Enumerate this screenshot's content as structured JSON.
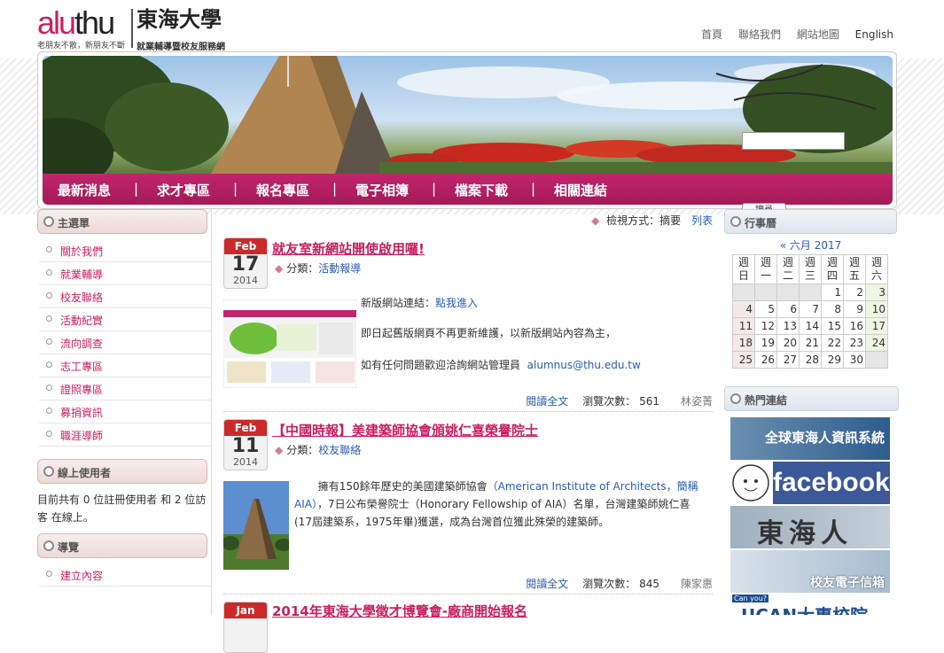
{
  "header": {
    "logo_a": "alu",
    "logo_b": "thu",
    "logo_cn": "東海大學",
    "logo_tagline": "老朋友不散，新朋友不斷",
    "logo_sub": "就業輔導暨校友服務網",
    "top_links": [
      "首頁",
      "聯絡我們",
      "網站地圖",
      "English"
    ]
  },
  "nav": {
    "items": [
      "最新消息",
      "求才專區",
      "報名專區",
      "電子相簿",
      "檔案下載",
      "相關連結"
    ],
    "separator": "|",
    "search_button": "搜尋"
  },
  "left": {
    "main_menu_title": "主選單",
    "menu": [
      "關於我們",
      "就業輔導",
      "校友聯絡",
      "活動紀實",
      "流向調查",
      "志工專區",
      "證照專區",
      "募捐資訊",
      "職涯導師"
    ],
    "online_title": "線上使用者",
    "online_text": "目前共有 0 位註冊使用者 和 2 位訪客 在線上。",
    "nav_title": "導覽",
    "nav_items": [
      "建立內容"
    ]
  },
  "main": {
    "view_label": "檢視方式：摘要",
    "view_list": "列表",
    "posts": [
      {
        "month": "Feb",
        "day": "17",
        "year": "2014",
        "title": "就友室新網站開使啟用囉!",
        "category_label": "分類：",
        "category": "活動報導",
        "line1_prefix": "新版網站連結：",
        "line1_link": "點我進入",
        "line2": "即日起舊版網頁不再更新維護，以新版網站內容為主，",
        "line3_prefix": "如有任何問題歡迎洽詢網站管理員",
        "line3_email": "alumnus@thu.edu.tw",
        "read_more": "閱讀全文",
        "views_label": "瀏覽次數：",
        "views": "561",
        "author": "林姿菁"
      },
      {
        "month": "Feb",
        "day": "11",
        "year": "2014",
        "title": "【中國時報】美建築師協會頒姚仁喜榮譽院士",
        "category_label": "分類：",
        "category": "校友聯絡",
        "body_a": "擁有150餘年歷史的美國建築師協會",
        "body_link": "（American Institute of Architects，簡稱AIA）",
        "body_b": "，7日公布榮譽院士（Honorary Fellowship of AIA）名單，台灣建築師姚仁喜(17屆建築系，1975年畢)獲選，成為台灣首位獲此殊榮的建築師。",
        "read_more": "閱讀全文",
        "views_label": "瀏覽次數：",
        "views": "845",
        "author": "陳家惠"
      },
      {
        "month": "Jan",
        "title": "2014年東海大學徵才博覽會-廠商開始報名"
      }
    ]
  },
  "right": {
    "calendar_title": "行事曆",
    "calendar_nav": "« 六月 2017",
    "weekdays": [
      "週日",
      "週一",
      "週二",
      "週三",
      "週四",
      "週五",
      "週六"
    ],
    "weeks": [
      [
        "",
        "",
        "",
        "",
        "1",
        "2",
        "3"
      ],
      [
        "4",
        "5",
        "6",
        "7",
        "8",
        "9",
        "10"
      ],
      [
        "11",
        "12",
        "13",
        "14",
        "15",
        "16",
        "17"
      ],
      [
        "18",
        "19",
        "20",
        "21",
        "22",
        "23",
        "24"
      ],
      [
        "25",
        "26",
        "27",
        "28",
        "29",
        "30",
        ""
      ]
    ],
    "hot_title": "熱門連結",
    "links": [
      "全球東海人資訊系統",
      "facebook",
      "東海人",
      "校友電子信箱",
      "Can you?",
      "UCAN大專校院"
    ]
  },
  "colors": {
    "brand": "#c8205f",
    "nav_bg": "#b01e5d",
    "link": "#2a5db0",
    "date_header": "#cc2a2a"
  }
}
